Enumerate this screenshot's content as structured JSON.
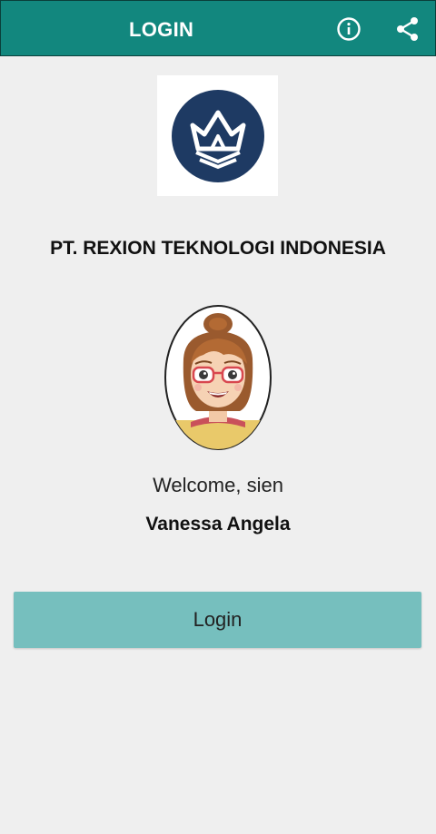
{
  "appbar": {
    "title": "LOGIN",
    "info_icon": "info-circle-icon",
    "share_icon": "share-icon",
    "bg_color": "#12877e"
  },
  "company": {
    "logo_icon": "crown-logo",
    "name": "PT. REXION TEKNOLOGI INDONESIA",
    "logo_color": "#1e3a63"
  },
  "user": {
    "avatar": "cartoon-woman-avatar",
    "greeting": "Welcome, sien",
    "name": "Vanessa Angela"
  },
  "actions": {
    "login_label": "Login",
    "login_color": "#76bfbe"
  }
}
